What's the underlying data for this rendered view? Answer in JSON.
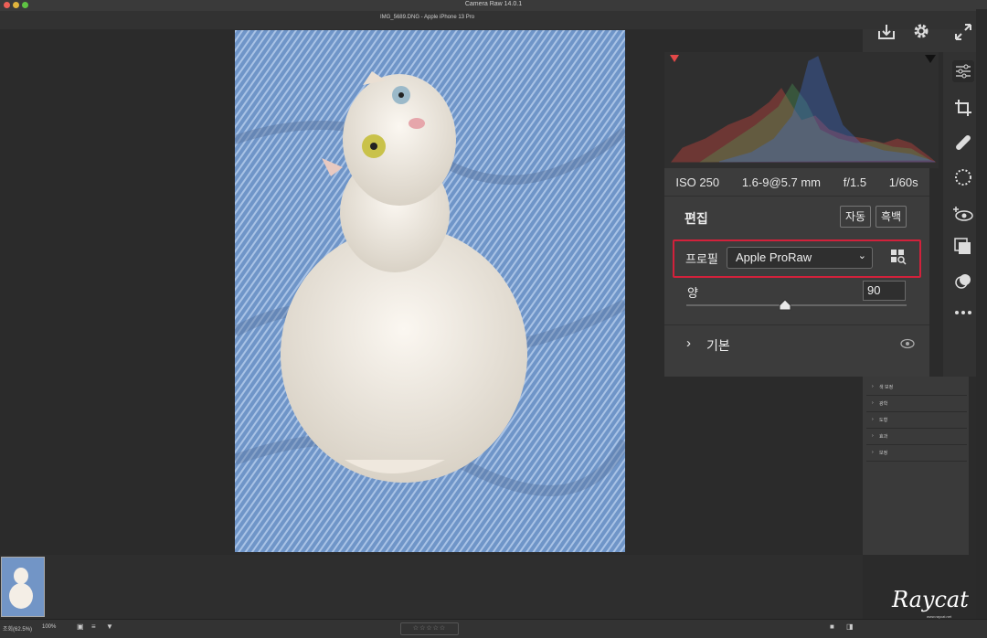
{
  "window": {
    "app_title": "Camera Raw 14.0.1",
    "doc_title": "IMG_5689.DNG  -  Apple iPhone 13 Pro"
  },
  "exif": {
    "iso": "ISO 250",
    "lens": "1.6-9@5.7 mm",
    "aperture": "f/1.5",
    "shutter": "1/60s"
  },
  "edit": {
    "title": "편집",
    "auto_label": "자동",
    "bw_label": "흑백",
    "profile_label": "프로필",
    "profile_value": "Apple ProRaw",
    "amount_label": "양",
    "amount_value": "90",
    "amount_level": 0.45,
    "basic_label": "기본"
  },
  "mini_panels": [
    "색 보정",
    "광학",
    "도형",
    "효과",
    "보정"
  ],
  "bottom": {
    "zoom_text": "조회(62.5%)",
    "zoom_pct": "100%",
    "stars": "☆☆☆☆☆"
  },
  "watermark": {
    "text": "Raycat",
    "sub": "www.raycat.net"
  },
  "colors": {
    "highlight_border": "#d2213b",
    "panel_bg": "#3c3c3c",
    "histogram_red": "#e0463f",
    "histogram_green": "#4fae5c",
    "histogram_blue": "#3f6fd6"
  },
  "icons": [
    "open-save-icon",
    "gear-icon",
    "fullscreen-icon",
    "edit-sliders-icon",
    "crop-icon",
    "heal-icon",
    "mask-icon",
    "redeye-icon",
    "presets-icon",
    "snapshots-icon",
    "more-icon"
  ]
}
